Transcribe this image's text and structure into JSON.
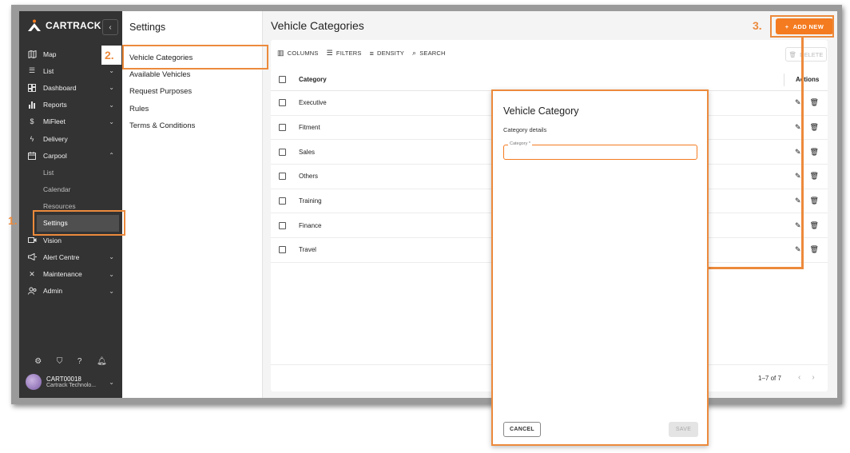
{
  "sidebar": {
    "brand": "CARTRACK",
    "collapse_icon": "chevron-left-icon",
    "items": [
      {
        "label": "Map",
        "icon": "map-icon",
        "chevron": ""
      },
      {
        "label": "List",
        "icon": "list-icon",
        "chevron": "⌄"
      },
      {
        "label": "Dashboard",
        "icon": "dashboard-icon",
        "chevron": "⌄"
      },
      {
        "label": "Reports",
        "icon": "bar-chart-icon",
        "chevron": "⌄"
      },
      {
        "label": "MiFleet",
        "icon": "dollar-icon",
        "chevron": "⌄"
      },
      {
        "label": "Delivery",
        "icon": "lightning-icon",
        "chevron": ""
      },
      {
        "label": "Carpool",
        "icon": "calendar-icon",
        "chevron": "⌃"
      }
    ],
    "carpool_sub": [
      "List",
      "Calendar",
      "Resources",
      "Settings"
    ],
    "items_after": [
      {
        "label": "Vision",
        "icon": "camera-icon",
        "chevron": ""
      },
      {
        "label": "Alert Centre",
        "icon": "megaphone-icon",
        "chevron": "⌄"
      },
      {
        "label": "Maintenance",
        "icon": "tools-icon",
        "chevron": "⌄"
      },
      {
        "label": "Admin",
        "icon": "users-icon",
        "chevron": "⌄"
      }
    ],
    "user": {
      "id": "CART00018",
      "org": "Cartrack Technolo..."
    }
  },
  "settings_panel": {
    "title": "Settings",
    "items": [
      "Vehicle Categories",
      "Available Vehicles",
      "Request Purposes",
      "Rules",
      "Terms & Conditions"
    ]
  },
  "main": {
    "title": "Vehicle Categories",
    "add_button": "ADD NEW",
    "toolbar": {
      "columns": "COLUMNS",
      "filters": "FILTERS",
      "density": "DENSITY",
      "search": "SEARCH",
      "delete": "DELETE"
    },
    "table": {
      "headers": {
        "category": "Category",
        "actions": "Actions"
      },
      "rows": [
        "Executive",
        "Fitment",
        "Sales",
        "Others",
        "Training",
        "Finance",
        "Travel"
      ]
    },
    "pagination": "1–7 of 7"
  },
  "dialog": {
    "title": "Vehicle Category",
    "subtitle": "Category details",
    "field_label": "Category *",
    "field_value": "",
    "cancel": "CANCEL",
    "save": "SAVE"
  },
  "annotations": [
    "1.",
    "2.",
    "3."
  ],
  "colors": {
    "accent": "#f47b20",
    "highlight": "#ec8a3c",
    "sidebar": "#333333"
  }
}
